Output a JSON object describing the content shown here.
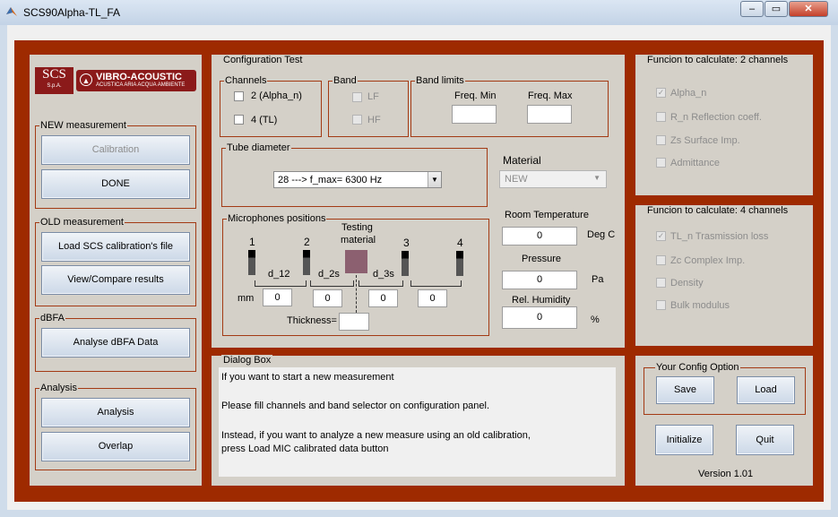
{
  "window": {
    "title": "SCS90Alpha-TL_FA",
    "controls": {
      "minimize": "–",
      "maximize": "▭",
      "close": "✕"
    }
  },
  "logo": {
    "scs": "SCS",
    "scs_sub": "S.p.A.",
    "brand": "VIBRO-ACOUSTIC",
    "tagline": "ACUSTICA ARIA ACQUA AMBIENTE"
  },
  "new_measurement": {
    "title": "NEW measurement",
    "calibration": "Calibration",
    "done": "DONE"
  },
  "old_measurement": {
    "title": "OLD measurement",
    "load": "Load SCS calibration's file",
    "view": "View/Compare results"
  },
  "dbfa": {
    "title": "dBFA",
    "analyse": "Analyse dBFA Data"
  },
  "analysis": {
    "title": "Analysis",
    "analysis": "Analysis",
    "overlap": "Overlap"
  },
  "config": {
    "title": "Configuration Test",
    "channels": {
      "title": "Channels",
      "opt1": "2 (Alpha_n)",
      "opt2": "4 (TL)"
    },
    "band": {
      "title": "Band",
      "lf": "LF",
      "hf": "HF"
    },
    "band_limits": {
      "title": "Band limits",
      "min_label": "Freq. Min",
      "max_label": "Freq. Max",
      "min_value": "",
      "max_value": ""
    },
    "tube": {
      "title": "Tube diameter",
      "selected": "28 ---> f_max= 6300 Hz"
    },
    "material": {
      "label": "Material",
      "selected": "NEW"
    },
    "mics": {
      "title": "Microphones positions",
      "n1": "1",
      "n2": "2",
      "n3": "3",
      "n4": "4",
      "testing": "Testing",
      "material": "material",
      "d12": "d_12",
      "d2s": "d_2s",
      "d3s": "d_3s",
      "mm": "mm",
      "v1": "0",
      "v2": "0",
      "v3": "0",
      "v4": "0",
      "thickness_label": "Thickness=",
      "thickness": ""
    },
    "room_temp": {
      "label": "Room Temperature",
      "value": "0",
      "unit": "Deg C"
    },
    "pressure": {
      "label": "Pressure",
      "value": "0",
      "unit": "Pa"
    },
    "humidity": {
      "label": "Rel. Humidity",
      "value": "0",
      "unit": "%"
    }
  },
  "func2": {
    "title": "Funcion to calculate: 2 channels",
    "items": [
      "Alpha_n",
      "R_n  Reflection coeff.",
      "Zs Surface Imp.",
      "Admittance"
    ]
  },
  "func4": {
    "title": "Funcion to calculate: 4 channels",
    "items": [
      "TL_n Trasmission loss",
      "Zc Complex Imp.",
      "Density",
      "Bulk modulus"
    ]
  },
  "dialog": {
    "title": "Dialog Box",
    "line1": "If you want to start a new measurement",
    "line2": "Please fill channels and band selector on configuration panel.",
    "line3": "Instead, if you want to analyze a  new measure using an old calibration,",
    "line4": "press Load MIC calibrated data button"
  },
  "your_config": {
    "title": "Your Config Option",
    "save": "Save",
    "load": "Load"
  },
  "initialize": "Initialize",
  "quit": "Quit",
  "version": "Version 1.01",
  "colors": {
    "frame_red": "#9e2a00",
    "panel_gray": "#d4d0c8",
    "button": "#cdd9e8"
  }
}
